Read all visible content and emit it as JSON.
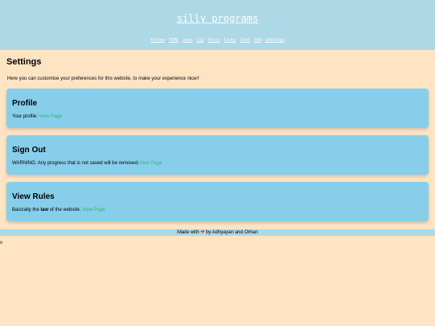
{
  "header": {
    "site_title": "silly programs",
    "nav": [
      "Python",
      "HTML",
      "Java",
      "CSS",
      "Posts",
      "Clubs",
      "Chat",
      "SSO",
      "Settings"
    ]
  },
  "main": {
    "title": "Settings",
    "intro": "Here you can customise your preferences for this website, to make your experience nicer!",
    "cards": [
      {
        "title": "Profile",
        "text": "Your profile: ",
        "link": "View Page"
      },
      {
        "title": "Sign Out",
        "text": "WARNING: Any progress that is not saved will be removed.",
        "link": "View Page"
      },
      {
        "title": "View Rules",
        "text_before": "Basically the ",
        "text_bold": "law",
        "text_after": " of the website. ",
        "link": "View Page"
      }
    ]
  },
  "footer": {
    "prefix": "Made with ",
    "suffix": " by Adhyayan and Orhan",
    "heart_icon": "heart-icon"
  },
  "stray_text": "v"
}
